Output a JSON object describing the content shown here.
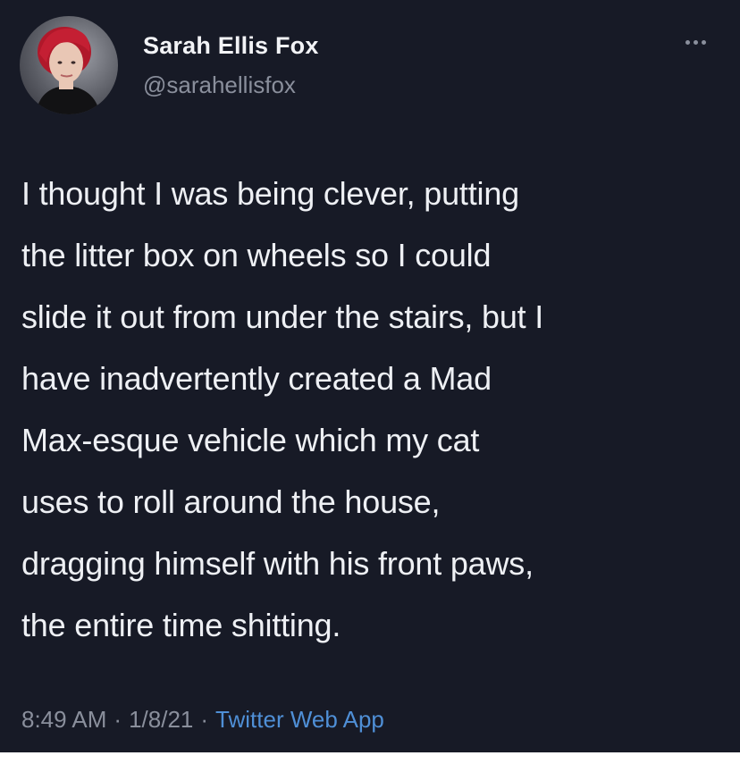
{
  "user": {
    "display_name": "Sarah Ellis Fox",
    "handle": "@sarahellisfox"
  },
  "tweet": {
    "text": "I thought I was being clever, putting\nthe litter box on wheels so I could\nslide it out from under the stairs, but I\nhave inadvertently created a Mad\nMax-esque vehicle which my cat\nuses to roll around the house,\ndragging himself with his front paws,\nthe entire time shitting.",
    "time": "8:49 AM",
    "separator": "·",
    "date": "1/8/21",
    "source": "Twitter Web App"
  },
  "icons": {
    "more": "more-horizontal-icon"
  },
  "colors": {
    "background": "#171a26",
    "text": "#eef0f4",
    "muted": "#8a8f9c",
    "link": "#4f8fd6"
  }
}
